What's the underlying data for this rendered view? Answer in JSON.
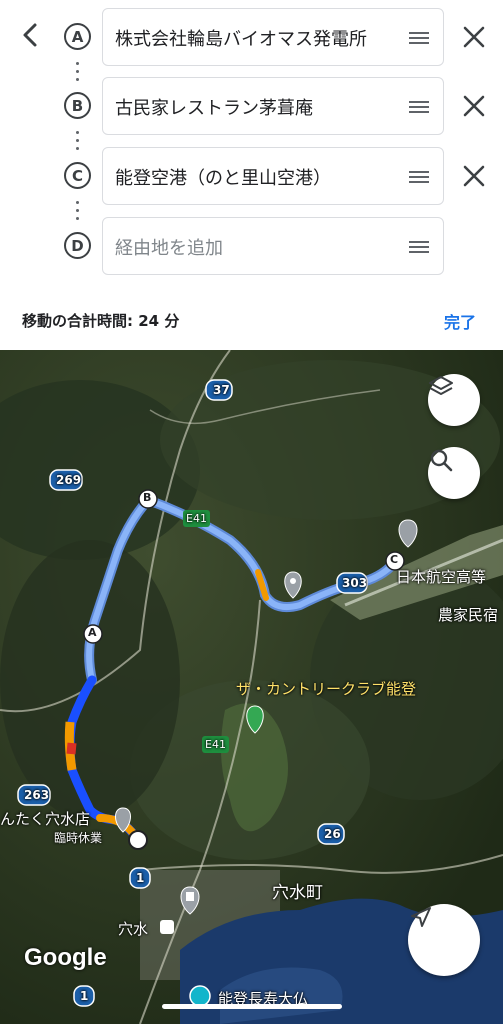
{
  "route": {
    "stops": [
      {
        "letter": "A",
        "text": "株式会社輪島バイオマス発電所",
        "placeholder": false
      },
      {
        "letter": "B",
        "text": "古民家レストラン茅葺庵",
        "placeholder": false
      },
      {
        "letter": "C",
        "text": "能登空港（のと里山空港）",
        "placeholder": false
      },
      {
        "letter": "D",
        "text": "経由地を追加",
        "placeholder": true
      }
    ],
    "total_time": "移動の合計時間: 24 分",
    "done_label": "完了"
  },
  "icons": {
    "back": "chevron-left-icon",
    "drag": "drag-handle-icon",
    "remove": "close-icon",
    "layers": "layers-icon",
    "search": "search-icon",
    "navigate": "navigation-arrow-icon"
  },
  "map": {
    "labels": {
      "road_37": "37",
      "road_269": "269",
      "road_e41_top": "E41",
      "road_303": "303",
      "road_e41_mid": "E41",
      "road_263": "263",
      "road_26": "26",
      "road_1a": "1",
      "road_1b": "1",
      "stop_a": "A",
      "stop_b": "B",
      "stop_c": "C",
      "school": "日本航空高等",
      "farm": "農家民宿",
      "golf": "ザ・カントリークラブ能登",
      "store": "んたく穴水店",
      "store_status": "臨時休業",
      "town": "穴水町",
      "station": "穴水",
      "temple": "能登長寿大仏",
      "attribution": "Google"
    },
    "colors": {
      "route_main": "#8ab4f8",
      "route_fast": "#1a4fff",
      "route_slow": "#f29900",
      "route_jam": "#d93025",
      "accent": "#1a73e8"
    }
  }
}
